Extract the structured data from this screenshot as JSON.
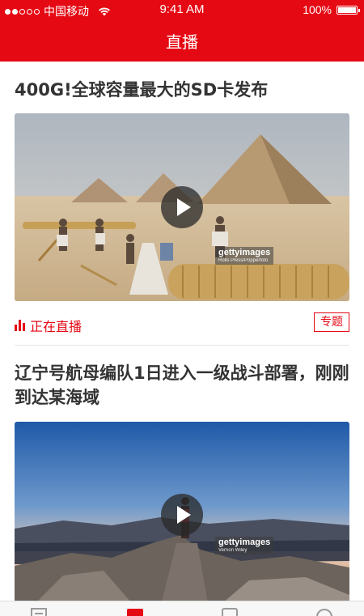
{
  "status_bar": {
    "carrier": "中国移动",
    "time": "9:41 AM",
    "battery": "100%"
  },
  "nav": {
    "title": "直播"
  },
  "feed": [
    {
      "title": "400G!全球容量最大的SD卡发布",
      "media_watermark": {
        "brand": "gettyimages",
        "credit": "Rolls Press/Popperfoto"
      },
      "live_label": "正在直播",
      "tag": "专题"
    },
    {
      "title": "辽宁号航母编队1日进入一级战斗部署，刚刚到达某海域",
      "media_watermark": {
        "brand": "gettyimages",
        "credit": "Vernon Wiley"
      }
    }
  ],
  "tab_bar": {
    "icons": [
      "news-tab-icon",
      "live-tab-icon",
      "video-tab-icon",
      "me-tab-icon"
    ],
    "active_color": "#e50914"
  },
  "colors": {
    "brand": "#e50914",
    "text": "#333333",
    "divider": "#e6e6e6"
  }
}
